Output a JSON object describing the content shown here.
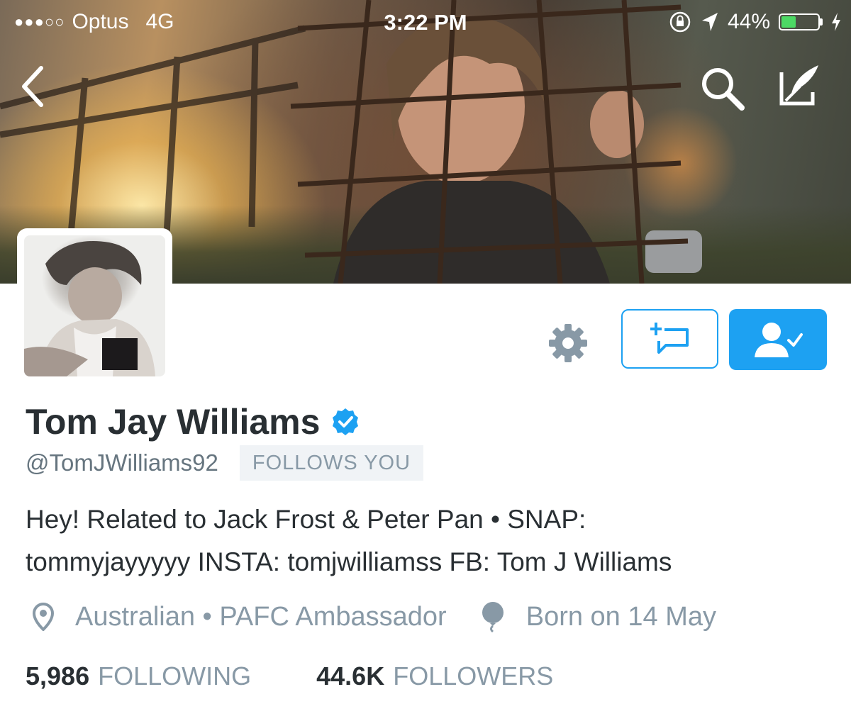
{
  "status_bar": {
    "carrier": "Optus",
    "network": "4G",
    "time": "3:22 PM",
    "battery": "44%",
    "battery_level": 0.44
  },
  "nav": {
    "back_icon": "chevron-left-icon",
    "search_icon": "search-icon",
    "compose_icon": "compose-tweet-icon"
  },
  "profile": {
    "name": "Tom Jay Williams",
    "verified": true,
    "handle": "@TomJWilliams92",
    "follows_you": "FOLLOWS YOU",
    "bio_line1": "Hey! Related to Jack Frost & Peter Pan • SNAP:",
    "bio_line2": "tommyjayyyyy INSTA: tomjwilliamss FB: Tom J Williams",
    "location": "Australian • PAFC Ambassador",
    "birthday": "Born on 14 May"
  },
  "stats": {
    "following_count": "5,986",
    "following_label": "FOLLOWING",
    "followers_count": "44.6K",
    "followers_label": "FOLLOWERS"
  },
  "actions": {
    "settings_icon": "gear-icon",
    "message_icon": "new-direct-message-icon",
    "following_icon": "user-following-check-icon"
  },
  "colors": {
    "accent": "#1da1f2",
    "text": "#292f33",
    "muted": "#8899a6",
    "battery": "#4cd964"
  }
}
